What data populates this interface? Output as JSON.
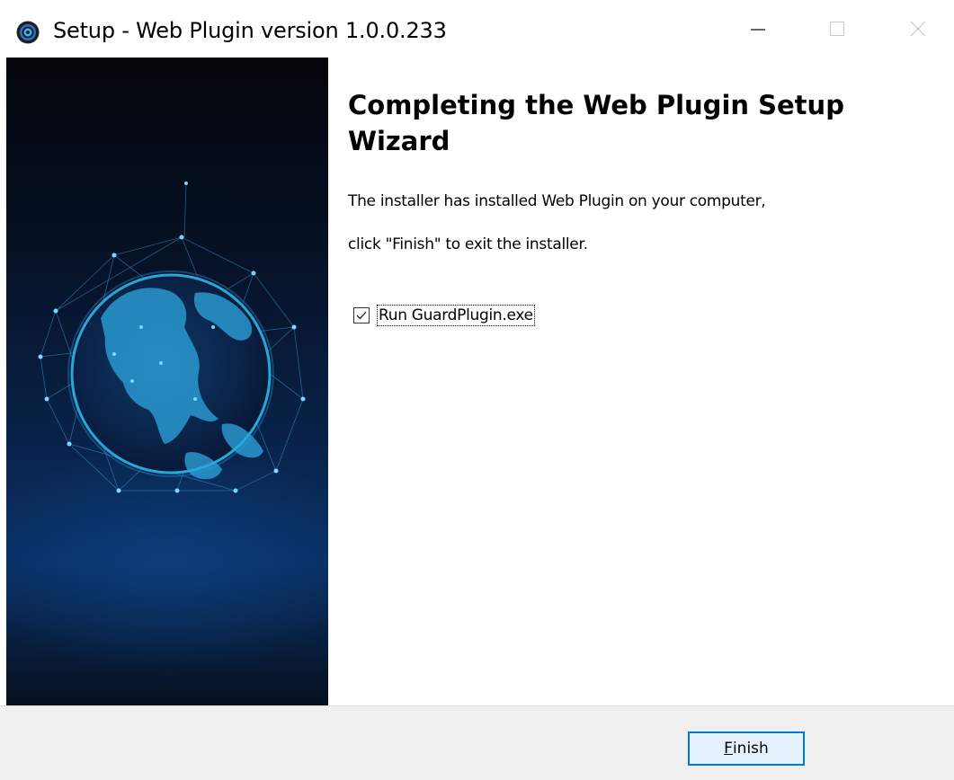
{
  "window": {
    "title": "Setup - Web Plugin version 1.0.0.233",
    "icons": {
      "app": "plugin-app-icon",
      "minimize": "minimize-icon",
      "maximize": "maximize-icon",
      "close": "close-icon"
    }
  },
  "main": {
    "heading": "Completing the Web Plugin Setup Wizard",
    "line1": "The installer has installed Web Plugin on your computer,",
    "line2": "click \"Finish\" to exit the installer.",
    "run_option": {
      "label": "Run GuardPlugin.exe",
      "checked": true
    }
  },
  "footer": {
    "finish_accel": "F",
    "finish_rest": "inish"
  },
  "colors": {
    "accent": "#0078d7",
    "button_bg": "#e5f1fb",
    "footer_bg": "#f0f0f0",
    "panel_dark": "#04060b",
    "panel_blue": "#0a2f63",
    "globe_glow": "#2ab8e8"
  }
}
